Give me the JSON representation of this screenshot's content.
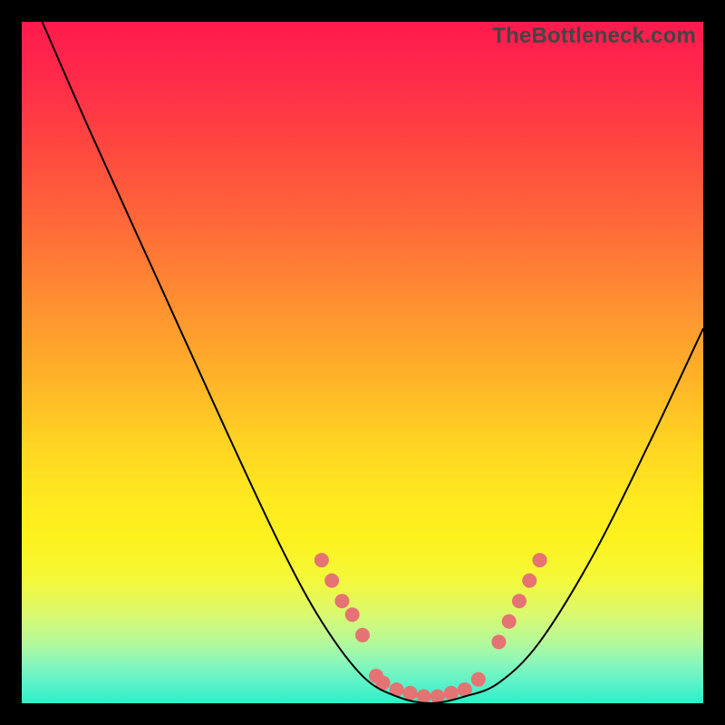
{
  "watermark": "TheBottleneck.com",
  "chart_data": {
    "type": "line",
    "title": "",
    "xlabel": "",
    "ylabel": "",
    "xlim": [
      0,
      100
    ],
    "ylim": [
      0,
      100
    ],
    "grid": false,
    "curve": {
      "name": "bottleneck-curve",
      "color": "#000000",
      "stroke_width": 2,
      "points": [
        {
          "x": 3,
          "y": 100
        },
        {
          "x": 10,
          "y": 84
        },
        {
          "x": 20,
          "y": 62
        },
        {
          "x": 30,
          "y": 40
        },
        {
          "x": 38,
          "y": 23
        },
        {
          "x": 44,
          "y": 12
        },
        {
          "x": 50,
          "y": 4
        },
        {
          "x": 55,
          "y": 1
        },
        {
          "x": 60,
          "y": 0
        },
        {
          "x": 65,
          "y": 1
        },
        {
          "x": 70,
          "y": 3
        },
        {
          "x": 76,
          "y": 9
        },
        {
          "x": 84,
          "y": 22
        },
        {
          "x": 92,
          "y": 38
        },
        {
          "x": 100,
          "y": 55
        }
      ]
    },
    "markers": {
      "name": "highlight-dots",
      "color": "#e57373",
      "radius": 8,
      "points": [
        {
          "x": 44,
          "y": 21
        },
        {
          "x": 45.5,
          "y": 18
        },
        {
          "x": 47,
          "y": 15
        },
        {
          "x": 48.5,
          "y": 13
        },
        {
          "x": 50,
          "y": 10
        },
        {
          "x": 52,
          "y": 4
        },
        {
          "x": 53,
          "y": 3
        },
        {
          "x": 55,
          "y": 2
        },
        {
          "x": 57,
          "y": 1.5
        },
        {
          "x": 59,
          "y": 1
        },
        {
          "x": 61,
          "y": 1
        },
        {
          "x": 63,
          "y": 1.5
        },
        {
          "x": 65,
          "y": 2
        },
        {
          "x": 67,
          "y": 3.5
        },
        {
          "x": 70,
          "y": 9
        },
        {
          "x": 71.5,
          "y": 12
        },
        {
          "x": 73,
          "y": 15
        },
        {
          "x": 74.5,
          "y": 18
        },
        {
          "x": 76,
          "y": 21
        }
      ]
    }
  }
}
